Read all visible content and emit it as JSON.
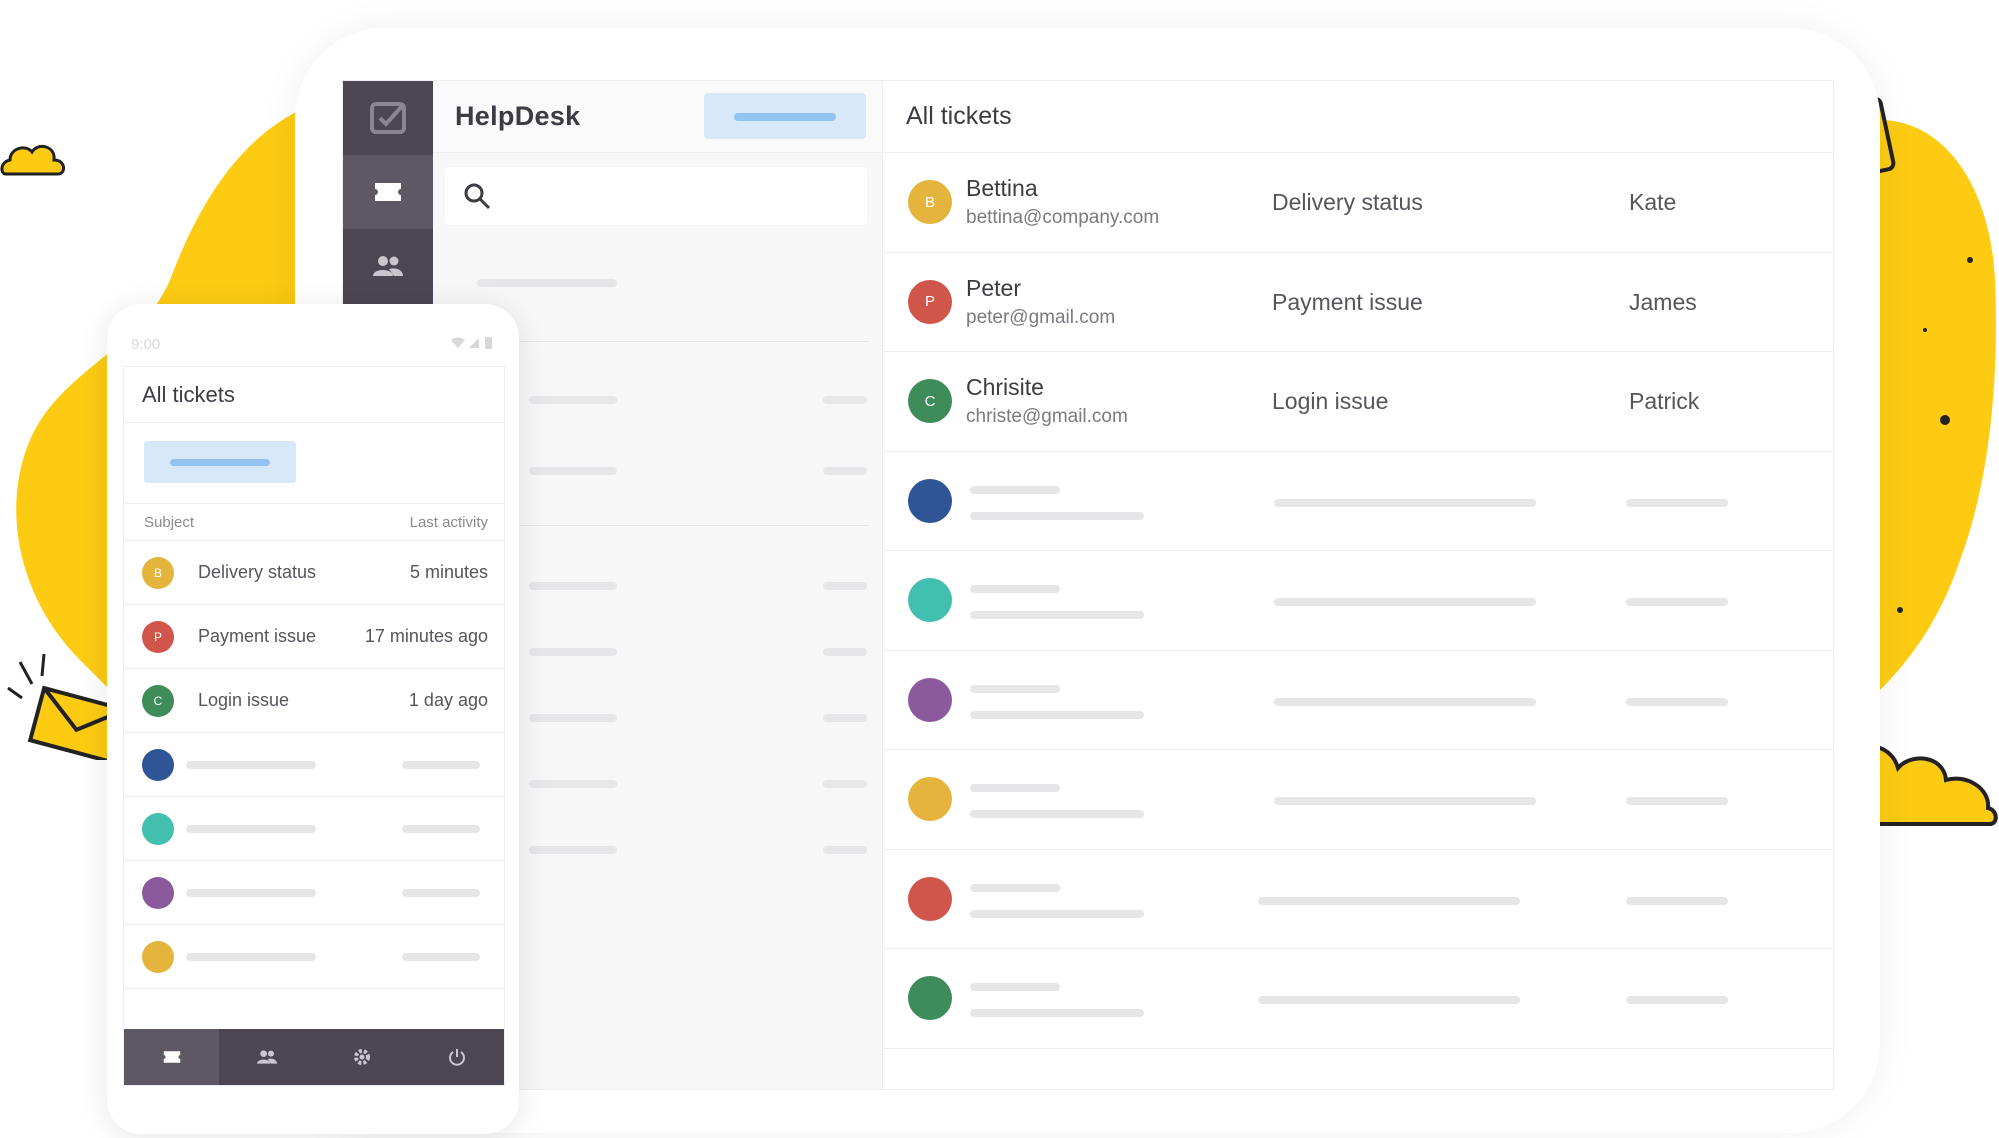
{
  "app": {
    "title": "HelpDesk"
  },
  "search": {
    "placeholder": ""
  },
  "main": {
    "title": "All tickets",
    "tickets": [
      {
        "initial": "B",
        "name": "Bettina",
        "email": "bettina@company.com",
        "subject": "Delivery status",
        "agent": "Kate",
        "color": "#e4b43c"
      },
      {
        "initial": "P",
        "name": "Peter",
        "email": "peter@gmail.com",
        "subject": "Payment issue",
        "agent": "James",
        "color": "#d0554a"
      },
      {
        "initial": "C",
        "name": "Chrisite",
        "email": "christe@gmail.com",
        "subject": "Login issue",
        "agent": "Patrick",
        "color": "#3e8c5a"
      }
    ],
    "placeholder_row_colors": [
      "#2f5597",
      "#43bfb0",
      "#8b5a9c",
      "#e4b43c",
      "#d0554a",
      "#3e8c5a"
    ]
  },
  "phone": {
    "time": "9:00",
    "title": "All tickets",
    "columns": {
      "subject": "Subject",
      "last_activity": "Last activity"
    },
    "tickets": [
      {
        "initial": "B",
        "subject": "Delivery status",
        "time": "5 minutes",
        "color": "#e4b43c"
      },
      {
        "initial": "P",
        "subject": "Payment issue",
        "time": "17 minutes ago",
        "color": "#d0554a"
      },
      {
        "initial": "C",
        "subject": "Login issue",
        "time": "1 day ago",
        "color": "#3e8c5a"
      }
    ],
    "placeholder_row_colors": [
      "#2f5597",
      "#43bfb0",
      "#8b5a9c",
      "#e4b43c"
    ],
    "nav_icons": [
      "ticket-icon",
      "users-icon",
      "gear-icon",
      "power-icon"
    ]
  },
  "colors": {
    "accent_yellow": "#fccb12",
    "sidebar": "#4b4652",
    "button_bg": "#d7e8fb",
    "button_bar": "#93c3f0"
  }
}
